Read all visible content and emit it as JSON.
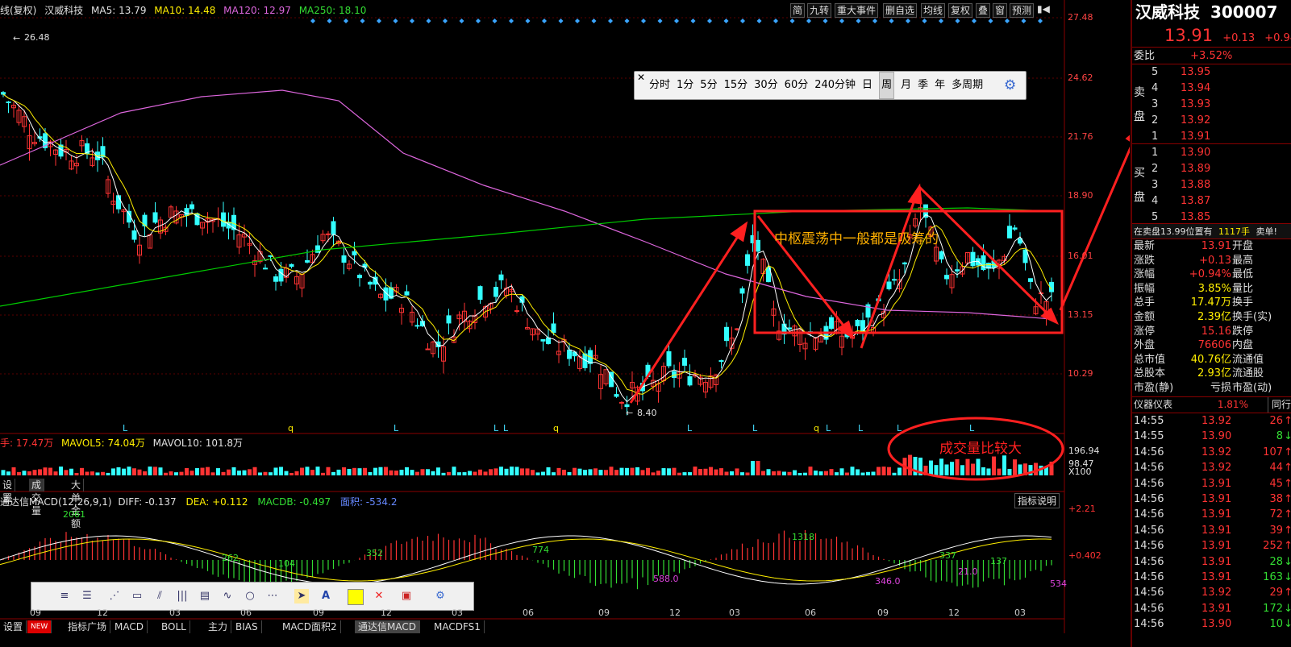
{
  "indicators": {
    "prefix": "线(复权)",
    "stock_name": "汉威科技",
    "ma5": "MA5: 13.79",
    "ma10": "MA10: 14.48",
    "ma120": "MA120: 12.97",
    "ma250": "MA250: 18.10"
  },
  "toolbar": [
    "简",
    "九转",
    "重大事件",
    "删自选",
    "均线",
    "复权",
    "叠",
    "窗",
    "预测"
  ],
  "price_axis": [
    "27.48",
    "24.62",
    "21.76",
    "18.90",
    "16.01",
    "13.15",
    "10.29"
  ],
  "markers": {
    "high": "26.48",
    "low": "8.40"
  },
  "period_bar": {
    "items": [
      "分时",
      "1分",
      "5分",
      "15分",
      "30分",
      "60分",
      "240分钟",
      "日",
      "周",
      "月",
      "季",
      "年",
      "多周期"
    ],
    "active": "周"
  },
  "annotations": {
    "box_text": "中枢震荡中一般都是吸筹的",
    "volume_text": "成交量比较大"
  },
  "letter_markers": [
    "L",
    "q",
    "L",
    "L",
    "L",
    "q",
    "L",
    "L",
    "q",
    "L",
    "L",
    "L",
    "L"
  ],
  "volume": {
    "hand": "手: 17.47万",
    "mavol5": "MAVOL5: 74.04万",
    "mavol10": "MAVOL10: 101.8万",
    "axis_top": "196.94",
    "axis_mid": "98.47",
    "axis_unit": "X100",
    "tabs": [
      "设置",
      "成交量",
      "大单金额"
    ]
  },
  "macd": {
    "label": "通达信MACD(12,26,9,1)",
    "diff": "DIFF: -0.137",
    "dea": "DEA: +0.112",
    "macdb": "MACDB: -0.497",
    "area": "面积: -534.2",
    "help": "指标说明",
    "axis": [
      "+2.21",
      "+0.402"
    ],
    "labels_green": [
      "2061",
      "262",
      "104",
      "352",
      "774",
      "1318",
      "337",
      "137"
    ],
    "labels_magenta": [
      "588.0",
      "346.0",
      "21.0",
      "534"
    ]
  },
  "time_axis": [
    "09",
    "12",
    "03",
    "06",
    "09",
    "12",
    "03",
    "06",
    "09",
    "12",
    "03",
    "06",
    "09",
    "12",
    "03"
  ],
  "bottom_tabs": [
    "设置",
    "NEW",
    "指标广场",
    "MACD",
    "BOLL",
    "主力",
    "BIAS",
    "MACD面积2",
    "通达信MACD",
    "MACDFS1"
  ],
  "quote": {
    "name": "汉威科技",
    "code": "300007",
    "price": "13.91",
    "change": "+0.13",
    "change_pct": "+0.94%",
    "weibi_label": "委比",
    "weibi": "+3.52%",
    "sell_label": "卖盘",
    "buy_label": "买盘",
    "asks": [
      {
        "lvl": "5",
        "px": "13.95"
      },
      {
        "lvl": "4",
        "px": "13.94"
      },
      {
        "lvl": "3",
        "px": "13.93"
      },
      {
        "lvl": "2",
        "px": "13.92"
      },
      {
        "lvl": "1",
        "px": "13.91"
      }
    ],
    "bids": [
      {
        "lvl": "1",
        "px": "13.90"
      },
      {
        "lvl": "2",
        "px": "13.89"
      },
      {
        "lvl": "3",
        "px": "13.88"
      },
      {
        "lvl": "4",
        "px": "13.87"
      },
      {
        "lvl": "5",
        "px": "13.85"
      }
    ],
    "notice": "在卖盘13.99位置有",
    "notice_qty": "1117手",
    "notice_tail": "卖单!",
    "stats": [
      {
        "k": "最新",
        "v": "13.91",
        "c": "red",
        "k2": "开盘"
      },
      {
        "k": "涨跌",
        "v": "+0.13",
        "c": "red",
        "k2": "最高"
      },
      {
        "k": "涨幅",
        "v": "+0.94%",
        "c": "red",
        "k2": "最低"
      },
      {
        "k": "振幅",
        "v": "3.85%",
        "c": "yel",
        "k2": "量比"
      },
      {
        "k": "总手",
        "v": "17.47万",
        "c": "yel",
        "k2": "换手"
      },
      {
        "k": "金额",
        "v": "2.39亿",
        "c": "yel",
        "k2": "换手(实)"
      },
      {
        "k": "涨停",
        "v": "15.16",
        "c": "red",
        "k2": "跌停"
      },
      {
        "k": "外盘",
        "v": "76606",
        "c": "red",
        "k2": "内盘"
      },
      {
        "k": "总市值",
        "v": "40.76亿",
        "c": "yel",
        "k2": "流通值"
      },
      {
        "k": "总股本",
        "v": "2.93亿",
        "c": "yel",
        "k2": "流通股"
      },
      {
        "k": "市盈(静)",
        "v": "亏损",
        "c": "wht",
        "k2": "市盈(动)"
      }
    ],
    "meter_label": "仪器仪表",
    "meter_pct": "1.81%",
    "meter_tab": "同行",
    "ticks": [
      {
        "t": "14:55",
        "p": "13.92",
        "v": "26",
        "c": "red"
      },
      {
        "t": "14:55",
        "p": "13.90",
        "v": "8",
        "c": "grn"
      },
      {
        "t": "14:56",
        "p": "13.92",
        "v": "107",
        "c": "red"
      },
      {
        "t": "14:56",
        "p": "13.92",
        "v": "44",
        "c": "red"
      },
      {
        "t": "14:56",
        "p": "13.91",
        "v": "45",
        "c": "red"
      },
      {
        "t": "14:56",
        "p": "13.91",
        "v": "38",
        "c": "red"
      },
      {
        "t": "14:56",
        "p": "13.91",
        "v": "72",
        "c": "red"
      },
      {
        "t": "14:56",
        "p": "13.91",
        "v": "39",
        "c": "red"
      },
      {
        "t": "14:56",
        "p": "13.91",
        "v": "252",
        "c": "red"
      },
      {
        "t": "14:56",
        "p": "13.91",
        "v": "28",
        "c": "grn"
      },
      {
        "t": "14:56",
        "p": "13.91",
        "v": "163",
        "c": "grn"
      },
      {
        "t": "14:56",
        "p": "13.92",
        "v": "29",
        "c": "red"
      },
      {
        "t": "14:56",
        "p": "13.91",
        "v": "172",
        "c": "grn"
      },
      {
        "t": "14:56",
        "p": "13.90",
        "v": "10",
        "c": "grn"
      }
    ]
  },
  "colors": {
    "up": "#ff3333",
    "down": "#33ffff",
    "ma5": "#ffffff",
    "ma10": "#ffee00",
    "ma120": "#dd66dd",
    "ma250": "#00cc00",
    "annot": "#ff2020"
  }
}
